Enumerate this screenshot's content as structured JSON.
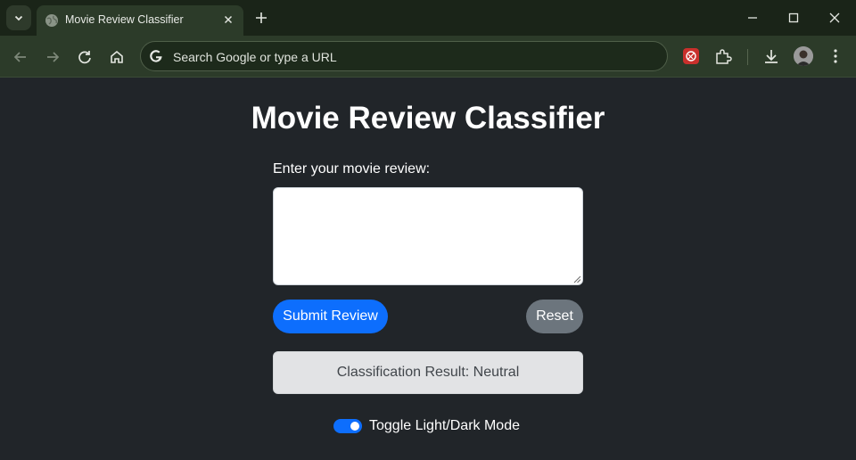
{
  "browser": {
    "tab_title": "Movie Review Classifier",
    "omnibox_placeholder": "Search Google or type a URL"
  },
  "page": {
    "title": "Movie Review Classifier",
    "review_label": "Enter your movie review:",
    "review_value": "",
    "submit_label": "Submit Review",
    "reset_label": "Reset",
    "result_text": "Classification Result: Neutral",
    "toggle_label": "Toggle Light/Dark Mode",
    "toggle_on": true
  },
  "colors": {
    "page_bg": "#212529",
    "primary": "#0d6efd",
    "secondary": "#6c757d",
    "result_bg": "#e2e3e5"
  }
}
